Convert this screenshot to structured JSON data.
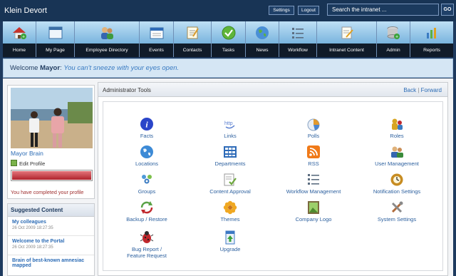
{
  "app": {
    "title": "Klein Devort"
  },
  "header": {
    "settings_label": "Settings",
    "logout_label": "Logout",
    "search_placeholder": "Search the intranet ...",
    "go_label": "GO"
  },
  "nav": {
    "items": [
      {
        "label": "Home",
        "icon": "home-icon"
      },
      {
        "label": "My Page",
        "icon": "window-icon"
      },
      {
        "label": "Employee Directory",
        "icon": "people-icon"
      },
      {
        "label": "Events",
        "icon": "calendar-icon"
      },
      {
        "label": "Contacts",
        "icon": "notepad-icon"
      },
      {
        "label": "Tasks",
        "icon": "checkmark-icon"
      },
      {
        "label": "News",
        "icon": "globe-icon"
      },
      {
        "label": "Workflow",
        "icon": "list-icon"
      },
      {
        "label": "Intranet Content",
        "icon": "document-edit-icon"
      },
      {
        "label": "Admin",
        "icon": "database-add-icon"
      },
      {
        "label": "Reports",
        "icon": "chart-icon"
      }
    ]
  },
  "welcome": {
    "prefix": "Welcome ",
    "name": "Mayor",
    "quote": "You can't sneeze with your eyes open."
  },
  "profile": {
    "name": "Mayor Brain",
    "edit_label": "Edit Profile",
    "completion": 1.0,
    "completed_text": "You have completed your profile"
  },
  "suggested": {
    "title": "Suggested Content",
    "items": [
      {
        "title": "My colleagues",
        "date": "26 Oct 2009 18:27:35"
      },
      {
        "title": "Welcome to the Portal",
        "date": "26 Oct 2009 18:27:35"
      },
      {
        "title": "Brain of best-known amnesiac mapped",
        "date": ""
      }
    ]
  },
  "admin": {
    "title": "Administrator Tools",
    "back_label": "Back",
    "forward_label": "Forward",
    "tools": [
      {
        "label": "Facts",
        "icon": "info-icon",
        "color": "#2a45c9"
      },
      {
        "label": "Links",
        "icon": "link-icon",
        "color": "#5a7fd0"
      },
      {
        "label": "Polls",
        "icon": "pie-chart-icon",
        "color": "#e39a2e"
      },
      {
        "label": "Roles",
        "icon": "roles-icon",
        "color": "#d8a521"
      },
      {
        "label": "Locations",
        "icon": "globe-icon",
        "color": "#3c8ad6"
      },
      {
        "label": "Departments",
        "icon": "grid-icon",
        "color": "#2e6bb8"
      },
      {
        "label": "RSS",
        "icon": "rss-icon",
        "color": "#f07a19"
      },
      {
        "label": "User Management",
        "icon": "users-icon",
        "color": "#3a8b3a"
      },
      {
        "label": "Groups",
        "icon": "groups-icon",
        "color": "#4e9ad8"
      },
      {
        "label": "Content Approval",
        "icon": "approval-icon",
        "color": "#6ea83e"
      },
      {
        "label": "Workflow Management",
        "icon": "list-icon",
        "color": "#5c6d80"
      },
      {
        "label": "Notification Settings",
        "icon": "bell-icon",
        "color": "#c78c22"
      },
      {
        "label": "Backup / Restore",
        "icon": "backup-icon",
        "color": "#5aa246"
      },
      {
        "label": "Themes",
        "icon": "flower-icon",
        "color": "#f0a822"
      },
      {
        "label": "Company Logo",
        "icon": "picture-icon",
        "color": "#7b6a3e"
      },
      {
        "label": "System Settings",
        "icon": "tools-icon",
        "color": "#b06a3a"
      },
      {
        "label": "Bug Report / Feature Request",
        "icon": "bug-icon",
        "color": "#c0282d"
      },
      {
        "label": "Upgrade",
        "icon": "upgrade-icon",
        "color": "#3c78c4"
      }
    ]
  }
}
